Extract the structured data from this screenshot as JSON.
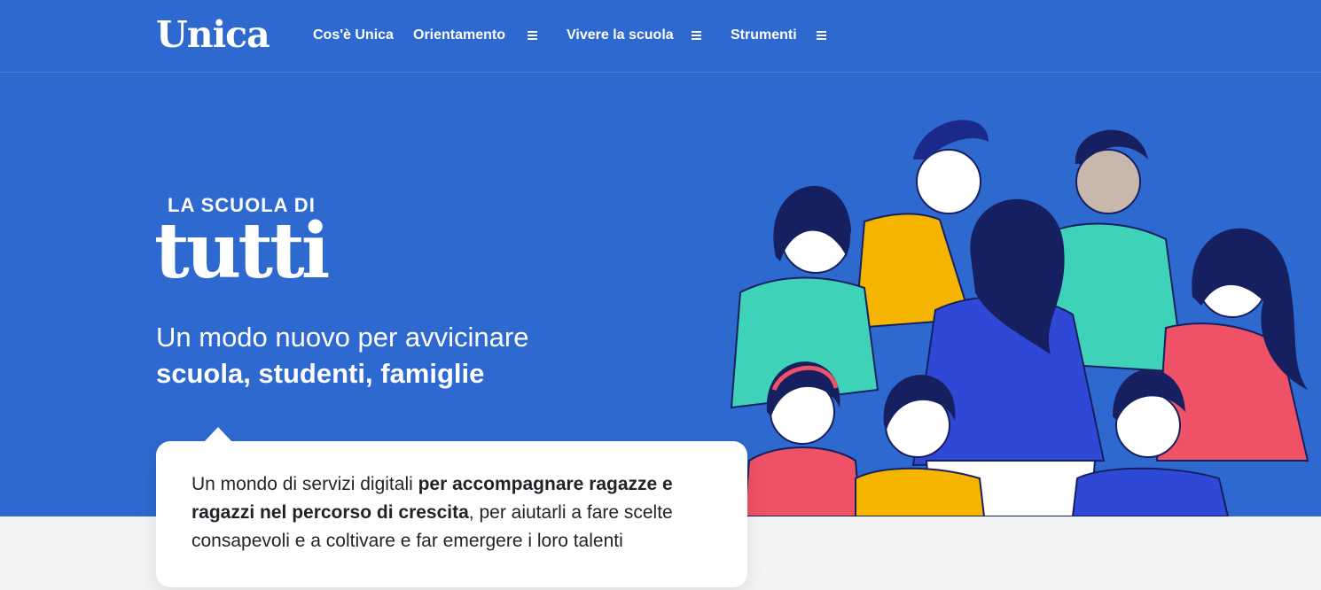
{
  "brand": {
    "logo": "Unica"
  },
  "nav": {
    "items": [
      {
        "label": "Cos'è Unica",
        "has_menu": false
      },
      {
        "label": "Orientamento",
        "has_menu": true
      },
      {
        "label": "Vivere la scuola",
        "has_menu": true
      },
      {
        "label": "Strumenti",
        "has_menu": true
      }
    ]
  },
  "hero": {
    "kicker": "LA SCUOLA DI",
    "title": "tutti",
    "subtitle_line1": "Un modo nuovo per avvicinare",
    "subtitle_line2": "scuola, studenti, famiglie",
    "illustration": "group-of-students-and-families-illustration"
  },
  "card": {
    "text_part1": "Un mondo di servizi digitali ",
    "text_bold": "per accompagnare ragazze e ragazzi nel percorso di crescita",
    "text_part2": ", per aiutarli a fare scelte consapevoli e a coltivare e far emergere i loro talenti"
  },
  "colors": {
    "brand_blue": "#2d69cf",
    "page_background": "#f3f4f6",
    "card_background": "#ffffff",
    "text_dark": "#1f2328"
  }
}
